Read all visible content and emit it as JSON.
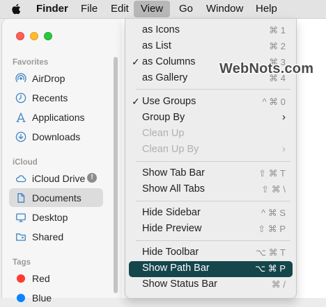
{
  "menubar": {
    "apple_icon": "apple-logo",
    "app": "Finder",
    "file": "File",
    "edit": "Edit",
    "view": "View",
    "go": "Go",
    "window": "Window",
    "help": "Help"
  },
  "sidebar": {
    "favorites_header": "Favorites",
    "favorites": [
      {
        "label": "AirDrop",
        "icon": "airdrop-icon"
      },
      {
        "label": "Recents",
        "icon": "clock-icon"
      },
      {
        "label": "Applications",
        "icon": "applications-icon"
      },
      {
        "label": "Downloads",
        "icon": "download-icon"
      }
    ],
    "icloud_header": "iCloud",
    "icloud": [
      {
        "label": "iCloud Drive",
        "icon": "cloud-icon"
      },
      {
        "label": "Documents",
        "icon": "document-icon",
        "selected": true
      },
      {
        "label": "Desktop",
        "icon": "desktop-icon"
      },
      {
        "label": "Shared",
        "icon": "shared-folder-icon"
      }
    ],
    "tags_header": "Tags",
    "tags": [
      {
        "label": "Red",
        "color": "#ff3b30"
      },
      {
        "label": "Blue",
        "color": "#0a84ff"
      }
    ]
  },
  "view_menu": {
    "items": [
      {
        "label": "as Icons",
        "shortcut": "⌘ 1"
      },
      {
        "label": "as List",
        "shortcut": "⌘ 2"
      },
      {
        "label": "as Columns",
        "shortcut": "⌘ 3",
        "checked": true
      },
      {
        "label": "as Gallery",
        "shortcut": "⌘ 4"
      },
      {
        "label": "Use Groups",
        "shortcut": "^ ⌘ 0",
        "checked": true
      },
      {
        "label": "Group By",
        "submenu": true
      },
      {
        "label": "Clean Up",
        "disabled": true
      },
      {
        "label": "Clean Up By",
        "disabled": true,
        "submenu": true
      },
      {
        "label": "Show Tab Bar",
        "shortcut": "⇧ ⌘ T"
      },
      {
        "label": "Show All Tabs",
        "shortcut": "⇧ ⌘ \\"
      },
      {
        "label": "Hide Sidebar",
        "shortcut": "^ ⌘ S"
      },
      {
        "label": "Hide Preview",
        "shortcut": "⇧ ⌘ P"
      },
      {
        "label": "Hide Toolbar",
        "shortcut": "⌥ ⌘ T"
      },
      {
        "label": "Show Path Bar",
        "shortcut": "⌥ ⌘ P",
        "highlighted": true
      },
      {
        "label": "Show Status Bar",
        "shortcut": "⌘ /"
      }
    ],
    "check_mark": "✓",
    "submenu_arrow": "›"
  },
  "watermark": "WebNots.com",
  "colors": {
    "highlight": "#14464b",
    "close": "#fe5f57",
    "minimize": "#febc2e",
    "maximize": "#28c840"
  }
}
